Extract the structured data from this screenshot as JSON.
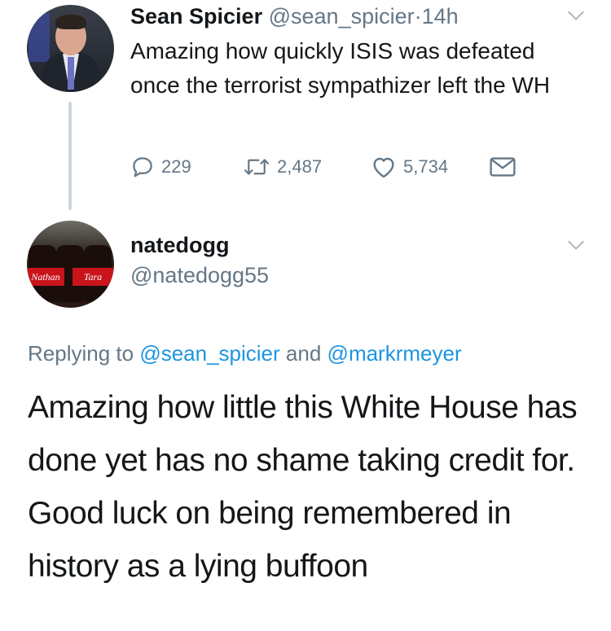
{
  "tweet": {
    "author_name": "Sean Spicier",
    "author_handle": "@sean_spicier",
    "separator": "·",
    "time": "14h",
    "text": "Amazing how quickly ISIS was defeated once the terrorist sympathizer left the WH",
    "replies": "229",
    "retweets": "2,487",
    "likes": "5,734"
  },
  "reply": {
    "author_name": "natedogg",
    "author_handle": "@natedogg55",
    "replying_prefix": "Replying to",
    "replying_mention_1": "@sean_spicier",
    "replying_and": "and",
    "replying_mention_2": "@markrmeyer",
    "text": "Amazing how little this White House has done yet has no shame taking credit for. Good luck on being remembered in history as a lying buffoon",
    "avatar_labels": [
      "Nathan",
      "Tara"
    ]
  },
  "icons": {
    "reply": "reply-icon",
    "retweet": "retweet-icon",
    "like": "heart-icon",
    "dm": "envelope-icon",
    "caret": "chevron-down-icon"
  },
  "colors": {
    "text": "#14171a",
    "secondary": "#657786",
    "link": "#1b95e0",
    "thread_line": "#ccd6dd"
  }
}
